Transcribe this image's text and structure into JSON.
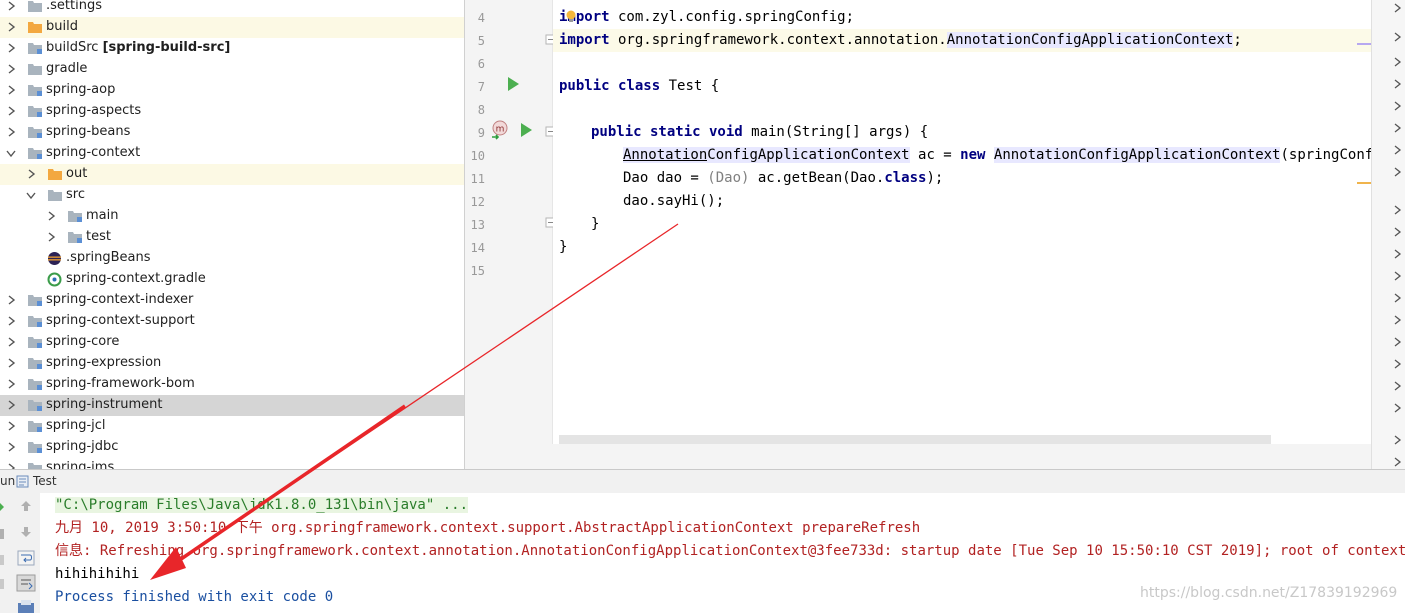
{
  "project_tree": {
    "items": [
      {
        "label": ".settings",
        "bold": ""
      },
      {
        "label": "build",
        "bold": ""
      },
      {
        "label": "buildSrc ",
        "bold": "[spring-build-src]"
      },
      {
        "label": "gradle",
        "bold": ""
      },
      {
        "label": "spring-aop",
        "bold": ""
      },
      {
        "label": "spring-aspects",
        "bold": ""
      },
      {
        "label": "spring-beans",
        "bold": ""
      },
      {
        "label": "spring-context",
        "bold": ""
      },
      {
        "label": "out",
        "bold": ""
      },
      {
        "label": "src",
        "bold": ""
      },
      {
        "label": "main",
        "bold": ""
      },
      {
        "label": "test",
        "bold": ""
      },
      {
        "label": ".springBeans",
        "bold": ""
      },
      {
        "label": "spring-context.gradle",
        "bold": ""
      },
      {
        "label": "spring-context-indexer",
        "bold": ""
      },
      {
        "label": "spring-context-support",
        "bold": ""
      },
      {
        "label": "spring-core",
        "bold": ""
      },
      {
        "label": "spring-expression",
        "bold": ""
      },
      {
        "label": "spring-framework-bom",
        "bold": ""
      },
      {
        "label": "spring-instrument",
        "bold": ""
      },
      {
        "label": "spring-jcl",
        "bold": ""
      },
      {
        "label": "spring-jdbc",
        "bold": ""
      },
      {
        "label": "spring-jms",
        "bold": ""
      }
    ]
  },
  "editor": {
    "line_numbers": [
      "4",
      "5",
      "6",
      "7",
      "8",
      "9",
      "10",
      "11",
      "12",
      "13",
      "14",
      "15"
    ],
    "code": {
      "l4_kw": "import",
      "l4_rest": " com.zyl.config.springConfig;",
      "l5_kw": "import",
      "l5_pkg": " org.springframework.context.annotation.",
      "l5_cls": "AnnotationConfigApplicationContext",
      "l5_end": ";",
      "l7_kw": "public class",
      "l7_rest": " Test {",
      "l9_kw": "public static void",
      "l9_rest": " main(String[] args) {",
      "l10_type_a": "Annotation",
      "l10_type_b": "ConfigApplicationContext",
      "l10_mid": " ac = ",
      "l10_new": "new",
      "l10_ctor": "AnnotationConfigApplicationContext",
      "l10_end": "(springConfig.c",
      "l11_a": "Dao dao = ",
      "l11_cast": "(Dao)",
      "l11_b": " ac.getBean(Dao.",
      "l11_cls": "class",
      "l11_end": ");",
      "l12": "dao.sayHi();",
      "l13": "}",
      "l14": "}"
    }
  },
  "run_panel": {
    "tab_prefix": "un",
    "tab_label": "Test",
    "lines": [
      "\"C:\\Program Files\\Java\\jdk1.8.0_131\\bin\\java\" ...",
      "九月 10, 2019 3:50:10 下午 org.springframework.context.support.AbstractApplicationContext prepareRefresh",
      "信息: Refreshing org.springframework.context.annotation.AnnotationConfigApplicationContext@3fee733d: startup date [Tue Sep 10 15:50:10 CST 2019]; root of context hierarc",
      "hihihihihi",
      "Process finished with exit code 0"
    ]
  },
  "watermark": "https://blog.csdn.net/Z17839192969",
  "colors": {
    "keyword": "#000080",
    "selected_row": "#d5d5d5",
    "annotation_arrow": "#e8262a",
    "console_red": "#b22222"
  }
}
